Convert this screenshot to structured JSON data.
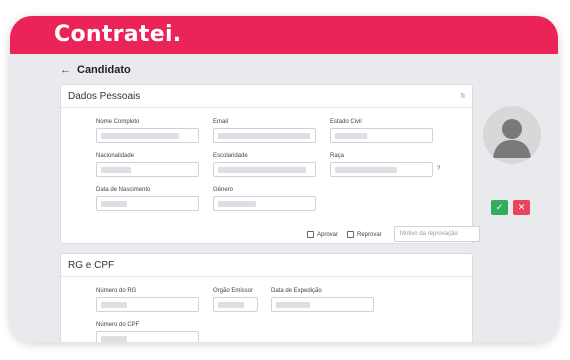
{
  "brand": {
    "name": "Contratei."
  },
  "header": {
    "back_icon": "arrow-left-icon",
    "title": "Candidato"
  },
  "dados_pessoais": {
    "title": "Dados Pessoais",
    "fields": {
      "nome_completo": "Nome Completo",
      "email": "Email",
      "estado_civil": "Estado Civil",
      "nacionalidade": "Nacionalidade",
      "escolaridade": "Escolaridade",
      "raca": "Raça",
      "data_nascimento": "Data de Nascimento",
      "genero": "Gênero"
    },
    "help_mark": "?",
    "approve_label": "Aprovar",
    "reject_label": "Reprovar",
    "reason_placeholder": "Motivo da reprovação"
  },
  "rg_cpf": {
    "title": "RG e CPF",
    "fields": {
      "numero_rg": "Número do RG",
      "orgao_emissor": "Orgão Emissor",
      "data_expedicao": "Data de Expedição",
      "numero_cpf": "Número do CPF"
    }
  },
  "actions": {
    "approve_icon": "✓",
    "reject_icon": "✕"
  },
  "colors": {
    "brand": "#ea2458",
    "approve": "#2fae5e",
    "reject": "#e9445a"
  }
}
